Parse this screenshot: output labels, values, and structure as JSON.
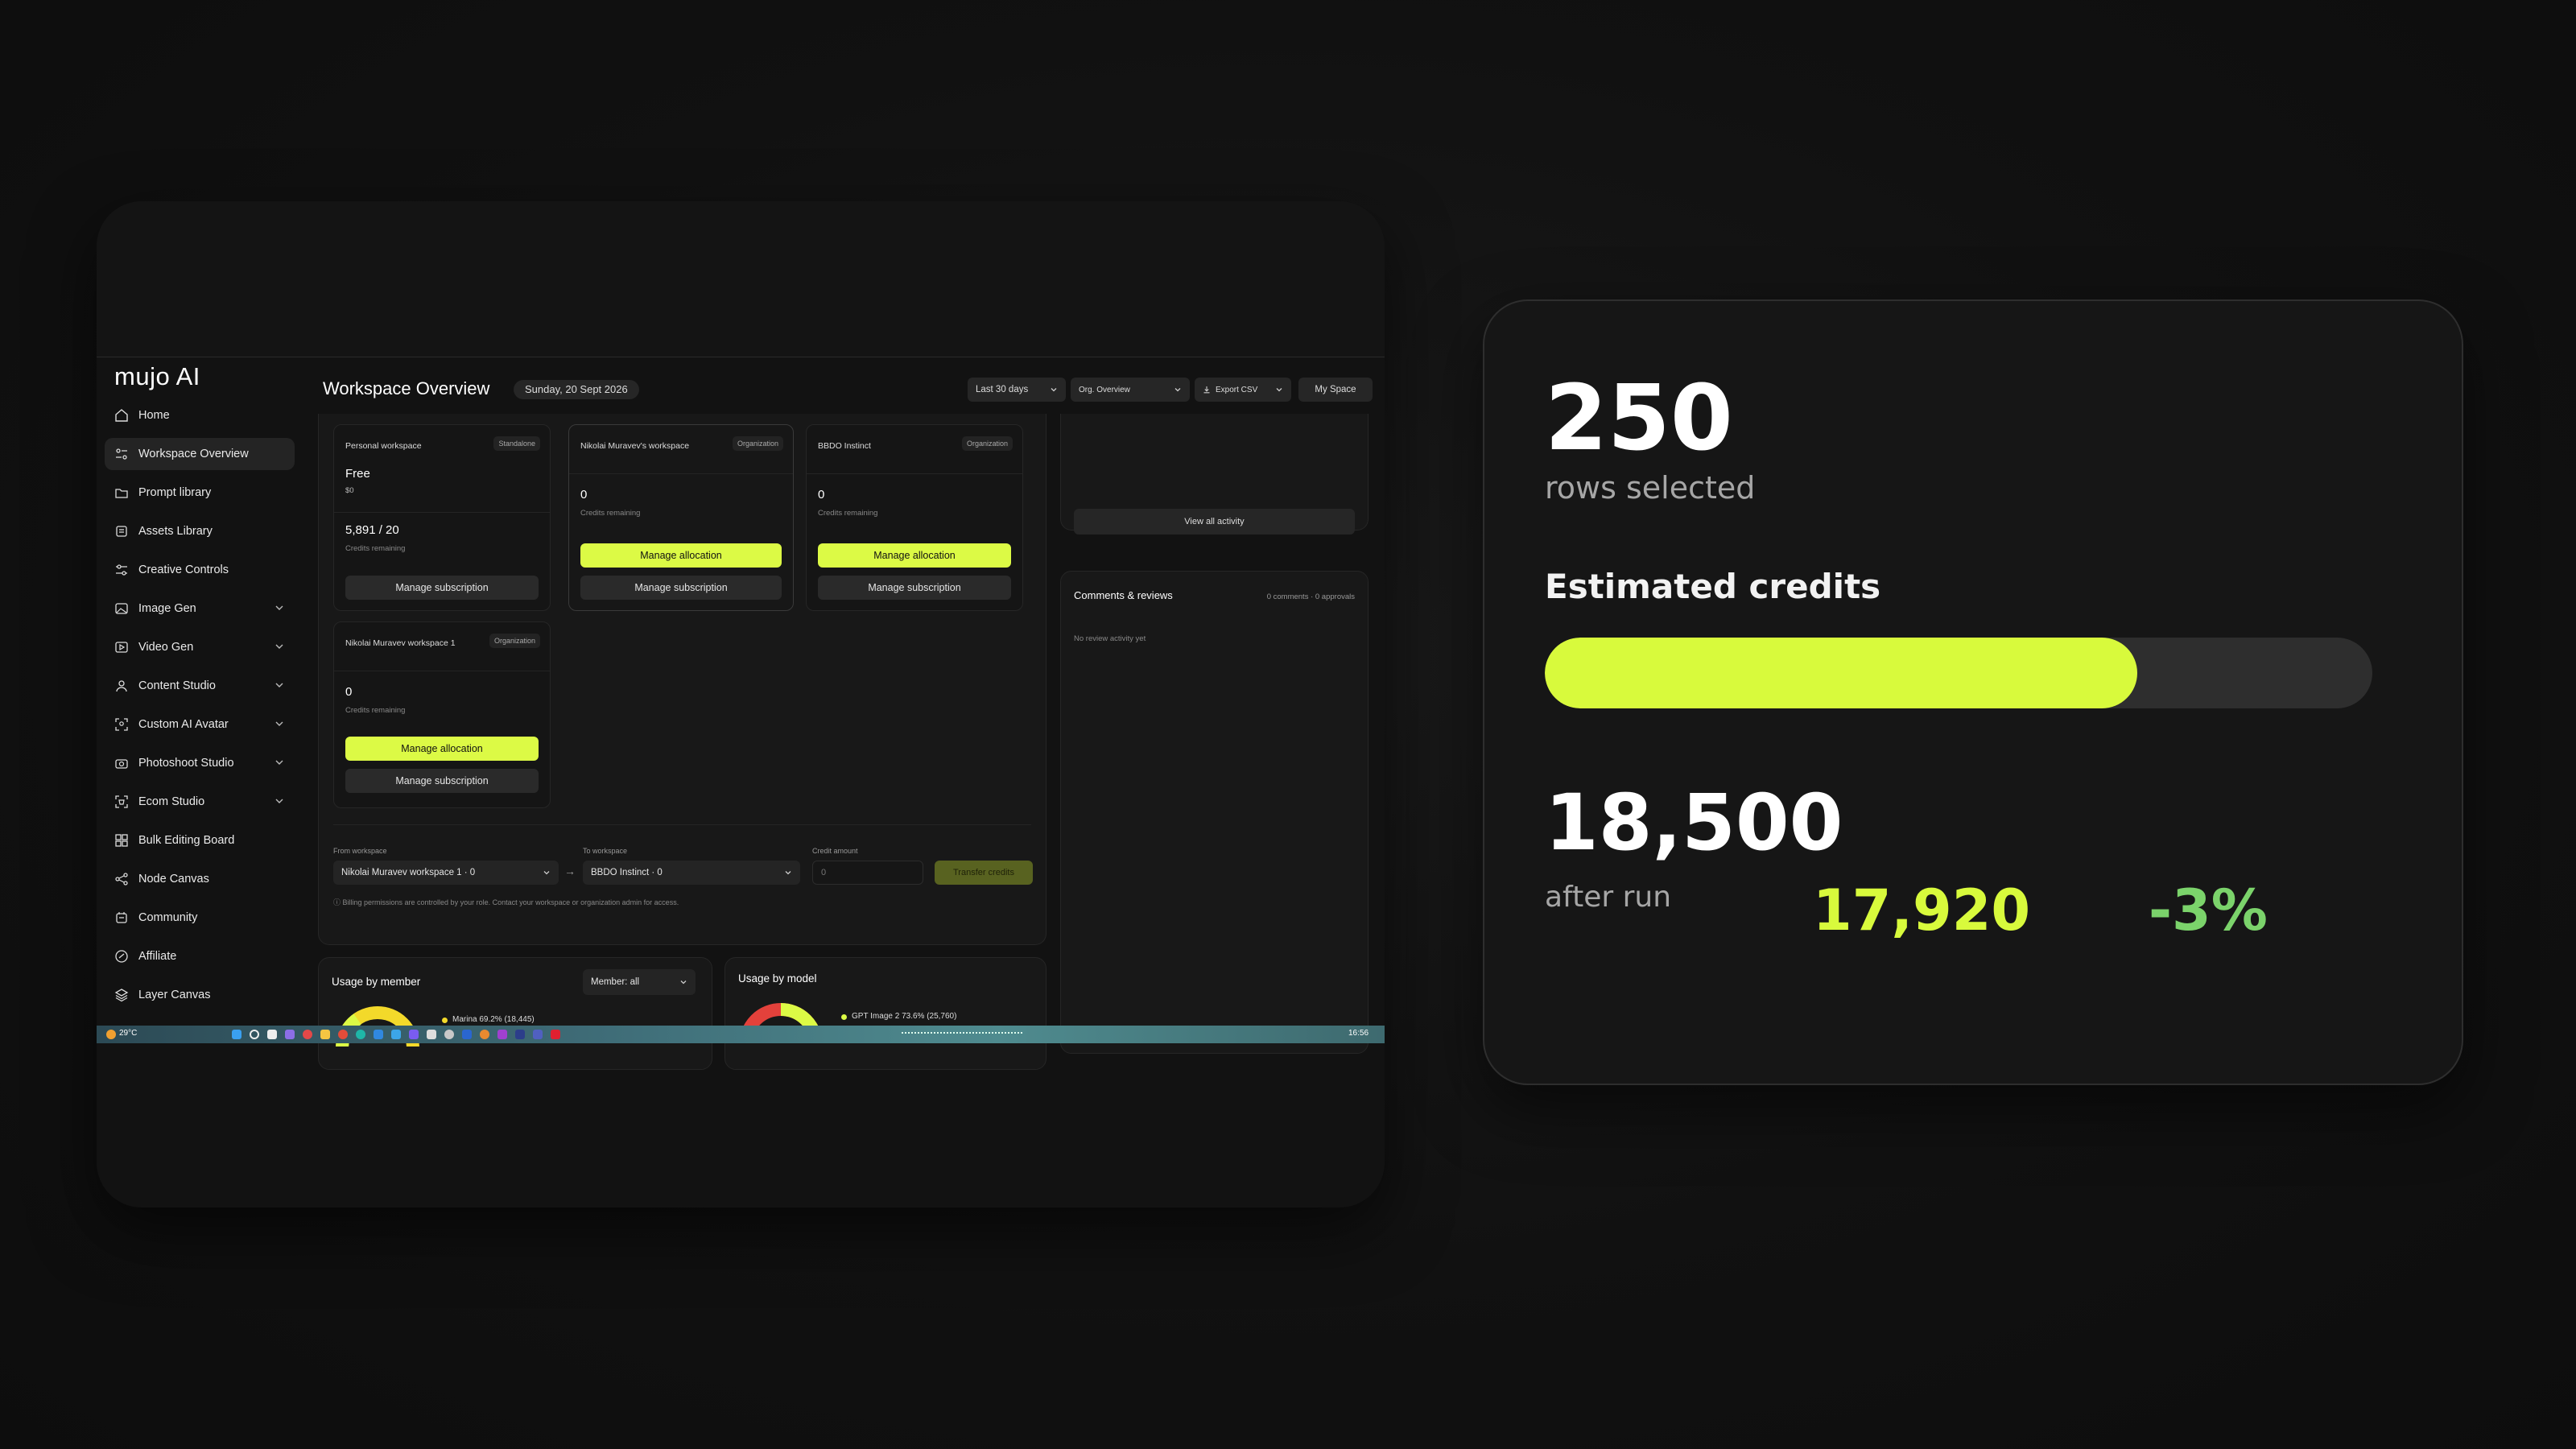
{
  "app": {
    "logo": "mujo AI",
    "page_title": "Workspace Overview",
    "date": "Sunday, 20 Sept 2026",
    "controls": {
      "range": "Last 30 days",
      "view": "Org. Overview",
      "export": "Export CSV",
      "space": "My Space"
    }
  },
  "sidebar": {
    "items": [
      {
        "label": "Home",
        "icon": "home-icon",
        "expandable": false
      },
      {
        "label": "Workspace Overview",
        "icon": "workspace-icon",
        "expandable": false,
        "active": true
      },
      {
        "label": "Prompt library",
        "icon": "folder-icon",
        "expandable": false
      },
      {
        "label": "Assets Library",
        "icon": "assets-icon",
        "expandable": false
      },
      {
        "label": "Creative Controls",
        "icon": "sliders-icon",
        "expandable": false
      },
      {
        "label": "Image Gen",
        "icon": "image-icon",
        "expandable": true
      },
      {
        "label": "Video Gen",
        "icon": "video-icon",
        "expandable": true
      },
      {
        "label": "Content Studio",
        "icon": "user-icon",
        "expandable": true
      },
      {
        "label": "Custom AI Avatar",
        "icon": "avatar-scan-icon",
        "expandable": true
      },
      {
        "label": "Photoshoot Studio",
        "icon": "camera-icon",
        "expandable": true
      },
      {
        "label": "Ecom Studio",
        "icon": "ecom-icon",
        "expandable": true
      },
      {
        "label": "Bulk Editing Board",
        "icon": "grid-icon",
        "expandable": false
      },
      {
        "label": "Node Canvas",
        "icon": "nodes-icon",
        "expandable": false
      },
      {
        "label": "Community",
        "icon": "community-icon",
        "expandable": false
      },
      {
        "label": "Affiliate",
        "icon": "affiliate-icon",
        "expandable": false
      },
      {
        "label": "Layer Canvas",
        "icon": "layers-icon",
        "expandable": false
      }
    ]
  },
  "workspaces": [
    {
      "name": "Personal workspace",
      "tag": "Standalone",
      "plan": "Free",
      "price": "$0",
      "credits": "5,891 / 20",
      "credits_label": "Credits remaining",
      "allocate": null,
      "subscription": "Manage subscription"
    },
    {
      "name": "Nikolai Muravev's workspace",
      "tag": "Organization",
      "credits": "0",
      "credits_label": "Credits remaining",
      "allocate": "Manage allocation",
      "subscription": "Manage subscription"
    },
    {
      "name": "BBDO Instinct",
      "tag": "Organization",
      "credits": "0",
      "credits_label": "Credits remaining",
      "allocate": "Manage allocation",
      "subscription": "Manage subscription"
    },
    {
      "name": "Nikolai Muravev workspace 1",
      "tag": "Organization",
      "credits": "0",
      "credits_label": "Credits remaining",
      "allocate": "Manage allocation",
      "subscription": "Manage subscription"
    }
  ],
  "transfer": {
    "from_label": "From workspace",
    "from_value": "Nikolai Muravev workspace 1 · 0",
    "to_label": "To workspace",
    "to_value": "BBDO Instinct · 0",
    "amount_label": "Credit amount",
    "amount_placeholder": "0",
    "button": "Transfer credits",
    "note": "ⓘ Billing permissions are controlled by your role. Contact your workspace or organization admin for access."
  },
  "activity": {
    "view_all": "View all activity"
  },
  "reviews": {
    "title": "Comments & reviews",
    "counts": "0 comments · 0 approvals",
    "empty": "No review activity yet"
  },
  "usage_member": {
    "title": "Usage by member",
    "filter": "Member: all",
    "legend": "Marina 69.2% (18,445)"
  },
  "usage_model": {
    "title": "Usage by model",
    "legend": "GPT Image 2 73.6% (25,760)"
  },
  "taskbar": {
    "weather": "29°C",
    "time": "16:56"
  },
  "stats": {
    "rows_count": "250",
    "rows_label": "rows selected",
    "estimate_label": "Estimated credits",
    "estimate_fraction": 0.716,
    "after_value": "18,500",
    "after_label": "after run",
    "highlight_value": "17,920",
    "change_pct": "-3%"
  },
  "colors": {
    "accent": "#dcfa45",
    "positive": "#7bd36b",
    "background": "#121212"
  }
}
